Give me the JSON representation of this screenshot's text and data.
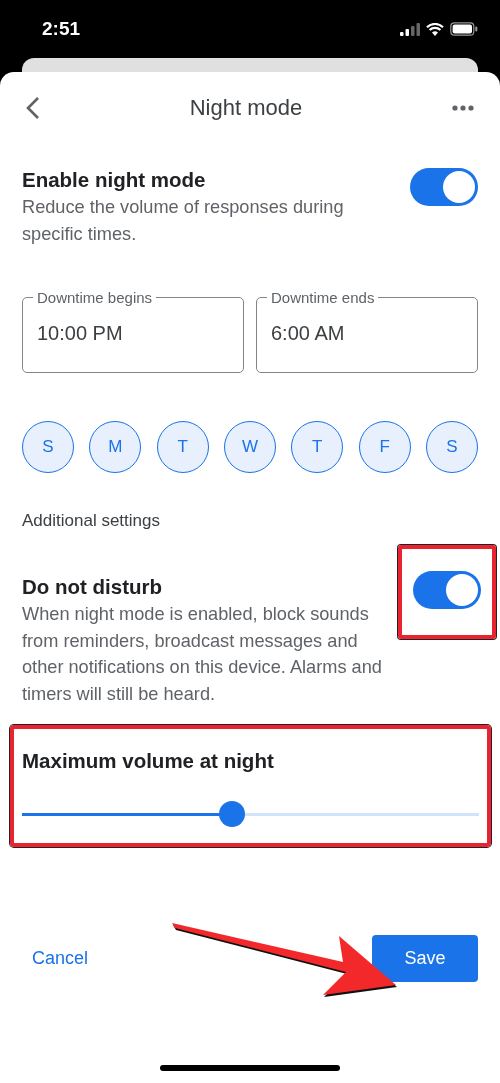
{
  "status_bar": {
    "time": "2:51"
  },
  "header": {
    "title": "Night mode"
  },
  "night_mode": {
    "title": "Enable night mode",
    "description": "Reduce the volume of responses during specific times.",
    "on": true
  },
  "downtime": [
    {
      "label": "Downtime begins",
      "value": "10:00 PM"
    },
    {
      "label": "Downtime ends",
      "value": "6:00 AM"
    }
  ],
  "days": [
    {
      "label": "S",
      "selected": true
    },
    {
      "label": "M",
      "selected": true
    },
    {
      "label": "T",
      "selected": true
    },
    {
      "label": "W",
      "selected": true
    },
    {
      "label": "T",
      "selected": true
    },
    {
      "label": "F",
      "selected": true
    },
    {
      "label": "S",
      "selected": true
    }
  ],
  "additional_settings": {
    "heading": "Additional settings"
  },
  "do_not_disturb": {
    "title": "Do not disturb",
    "description": "When night mode is enabled, block sounds from reminders, broadcast messages and other notifications on this device. Alarms and timers will still be heard.",
    "on": true
  },
  "volume": {
    "title": "Maximum volume at night",
    "level": 0.46
  },
  "footer": {
    "cancel": "Cancel",
    "save": "Save"
  }
}
